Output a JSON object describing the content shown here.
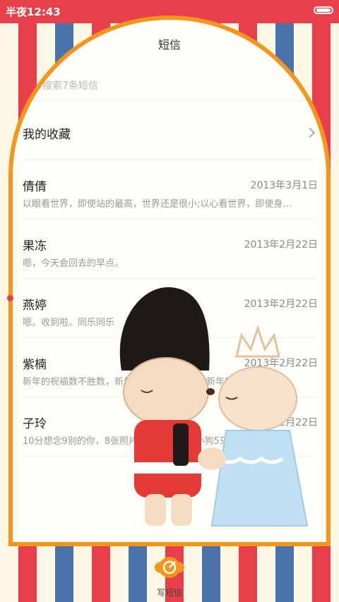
{
  "status_bar": {
    "time": "半夜12:43"
  },
  "header": {
    "title": "短信"
  },
  "search": {
    "placeholder": "搜索7条短信"
  },
  "favorites": {
    "label": "我的收藏"
  },
  "messages": [
    {
      "name": "倩倩",
      "date": "2013年3月1日",
      "snippet": "以眼看世界，即使站的最高，世界还是很小;以心看世界，即使身…"
    },
    {
      "name": "果冻",
      "date": "2013年2月22日",
      "snippet": "嗯，今天会回去的早点。"
    },
    {
      "name": "燕婷",
      "date": "2013年2月22日",
      "snippet": "嗯。收到啦。同乐同乐"
    },
    {
      "name": "紫楠",
      "date": "2013年2月22日",
      "snippet": "新年的祝福数不胜数，新年的愿望特多特多，新年的问候依旧美…"
    },
    {
      "name": "子玲",
      "date": "2013年2月22日",
      "snippet": "10分想念9别的你，8张照片7张是你，6只小狗5只像你，4根骨…"
    }
  ],
  "compose": {
    "label": "写短信",
    "icon": "compose-icon"
  },
  "colors": {
    "accent": "#e8404a",
    "frame": "#f3961b",
    "stripe_blue": "#4a73ad"
  }
}
